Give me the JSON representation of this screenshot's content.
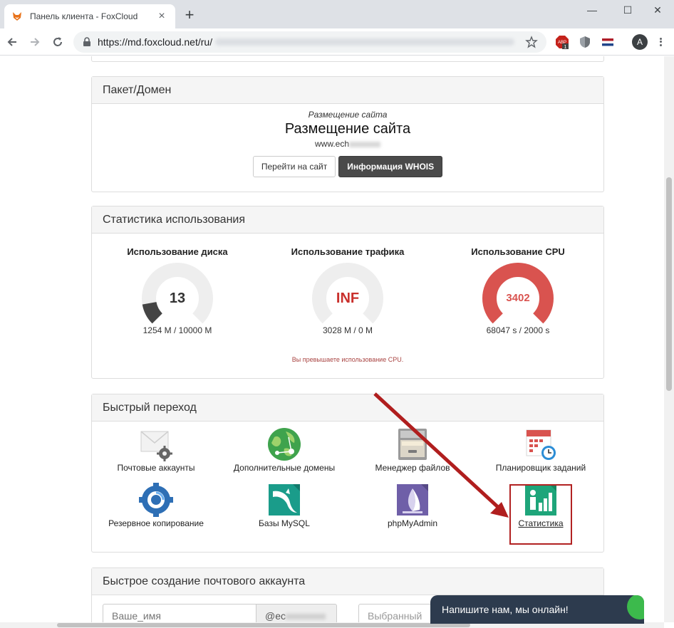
{
  "browser": {
    "tab_title": "Панель клиента - FoxCloud",
    "tab_close": "×",
    "new_tab": "+",
    "url": "https://md.foxcloud.net/ru/",
    "abp_badge": "1",
    "abp_label": "ABP",
    "avatar_letter": "A",
    "minimize": "—",
    "maximize": "☐",
    "close": "✕"
  },
  "package": {
    "heading": "Пакет/Домен",
    "italic": "Размещение сайта",
    "title": "Размещение сайта",
    "domain_prefix": "www.ech",
    "btn_goto": "Перейти на сайт",
    "btn_whois": "Информация WHOIS"
  },
  "stats": {
    "heading": "Статистика использования",
    "disk": {
      "label": "Использование диска",
      "value": "13",
      "caption": "1254 M / 10000 M",
      "fraction": 0.13
    },
    "traffic": {
      "label": "Использование трафика",
      "value": "INF",
      "caption": "3028 M / 0 M",
      "fraction": 0
    },
    "cpu": {
      "label": "Использование CPU",
      "value": "3402",
      "caption": "68047 s / 2000 s",
      "fraction": 1
    },
    "warning": "Вы превышаете использование CPU."
  },
  "quick": {
    "heading": "Быстрый переход",
    "mail": "Почтовые аккаунты",
    "domains": "Дополнительные домены",
    "files": "Менеджер файлов",
    "cron": "Планировщик заданий",
    "backup": "Резервное копирование",
    "mysql": "Базы MySQL",
    "pma": "phpMyAdmin",
    "stats": "Статистика"
  },
  "mailform": {
    "heading": "Быстрое создание почтового аккаунта",
    "name_placeholder": "Ваше_имя",
    "domain_prefix": "@ec",
    "select_placeholder": "Выбранный"
  },
  "chat": {
    "text": "Напишите нам, мы онлайн!"
  },
  "colors": {
    "gauge_bg": "#eeeeee",
    "disk": "#444444",
    "traffic_text": "#c9302c",
    "cpu": "#d9534f",
    "highlight": "#b22222"
  }
}
